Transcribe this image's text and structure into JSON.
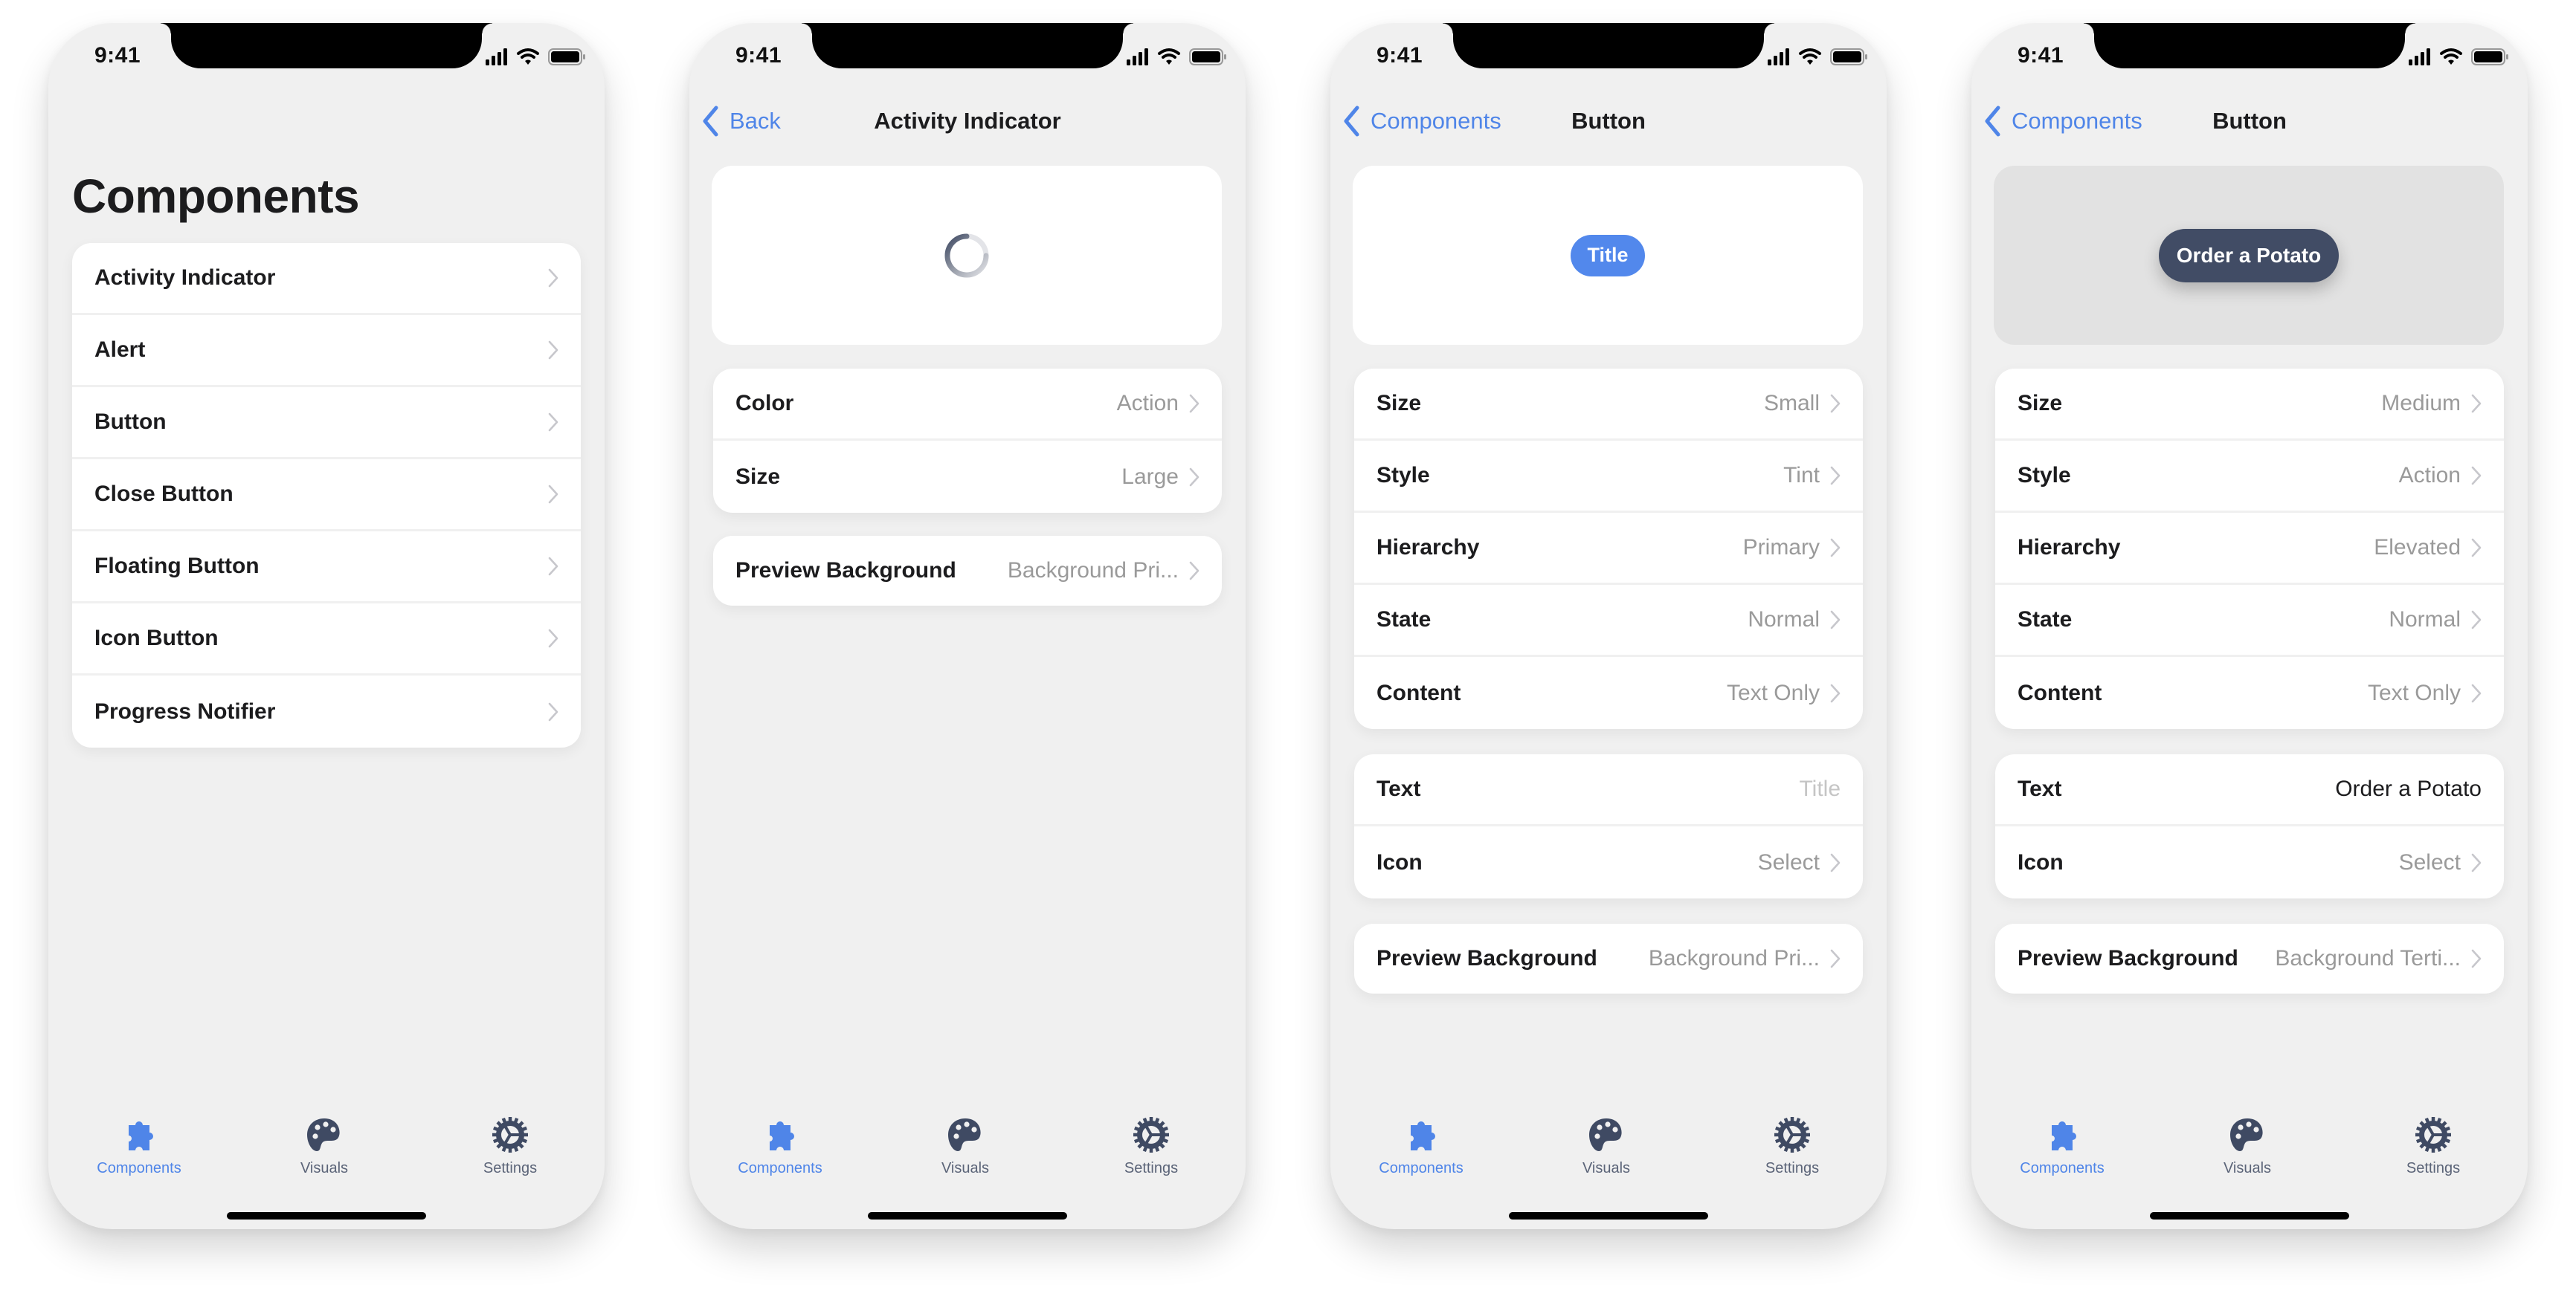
{
  "colors": {
    "accent": "#4f85e8",
    "screen_background": "#f0f0f0",
    "card_background": "#ffffff",
    "primary_text": "#1c1c1e",
    "secondary_text": "#9a9a9a",
    "tint_button": "#5288ec",
    "elevated_button": "#414c65",
    "tab_inactive": "#414c65"
  },
  "status_bar": {
    "time": "9:41"
  },
  "tab_bar": {
    "items": [
      {
        "label": "Components",
        "icon": "puzzle-piece-icon",
        "active": true
      },
      {
        "label": "Visuals",
        "icon": "palette-icon",
        "active": false
      },
      {
        "label": "Settings",
        "icon": "gear-icon",
        "active": false
      }
    ]
  },
  "screens": [
    {
      "large_title": "Components",
      "list": [
        {
          "label": "Activity Indicator"
        },
        {
          "label": "Alert"
        },
        {
          "label": "Button"
        },
        {
          "label": "Close Button"
        },
        {
          "label": "Floating Button"
        },
        {
          "label": "Icon Button"
        },
        {
          "label": "Progress Notifier"
        }
      ]
    },
    {
      "back_label": "Back",
      "title": "Activity Indicator",
      "preview": {
        "component": "activity-indicator-spinner"
      },
      "options": [
        {
          "label": "Color",
          "value": "Action"
        },
        {
          "label": "Size",
          "value": "Large"
        }
      ],
      "background_option": {
        "label": "Preview Background",
        "value": "Background Pri..."
      }
    },
    {
      "back_label": "Components",
      "title": "Button",
      "preview": {
        "button_label": "Title"
      },
      "options": [
        {
          "label": "Size",
          "value": "Small"
        },
        {
          "label": "Style",
          "value": "Tint"
        },
        {
          "label": "Hierarchy",
          "value": "Primary"
        },
        {
          "label": "State",
          "value": "Normal"
        },
        {
          "label": "Content",
          "value": "Text Only"
        }
      ],
      "content_options": [
        {
          "label": "Text",
          "value": "",
          "placeholder": "Title"
        },
        {
          "label": "Icon",
          "value": "Select"
        }
      ],
      "background_option": {
        "label": "Preview Background",
        "value": "Background Pri..."
      }
    },
    {
      "back_label": "Components",
      "title": "Button",
      "preview": {
        "button_label": "Order a Potato"
      },
      "options": [
        {
          "label": "Size",
          "value": "Medium"
        },
        {
          "label": "Style",
          "value": "Action"
        },
        {
          "label": "Hierarchy",
          "value": "Elevated"
        },
        {
          "label": "State",
          "value": "Normal"
        },
        {
          "label": "Content",
          "value": "Text Only"
        }
      ],
      "content_options": [
        {
          "label": "Text",
          "value": "Order a Potato",
          "placeholder": "Title"
        },
        {
          "label": "Icon",
          "value": "Select"
        }
      ],
      "background_option": {
        "label": "Preview Background",
        "value": "Background Terti..."
      }
    }
  ]
}
